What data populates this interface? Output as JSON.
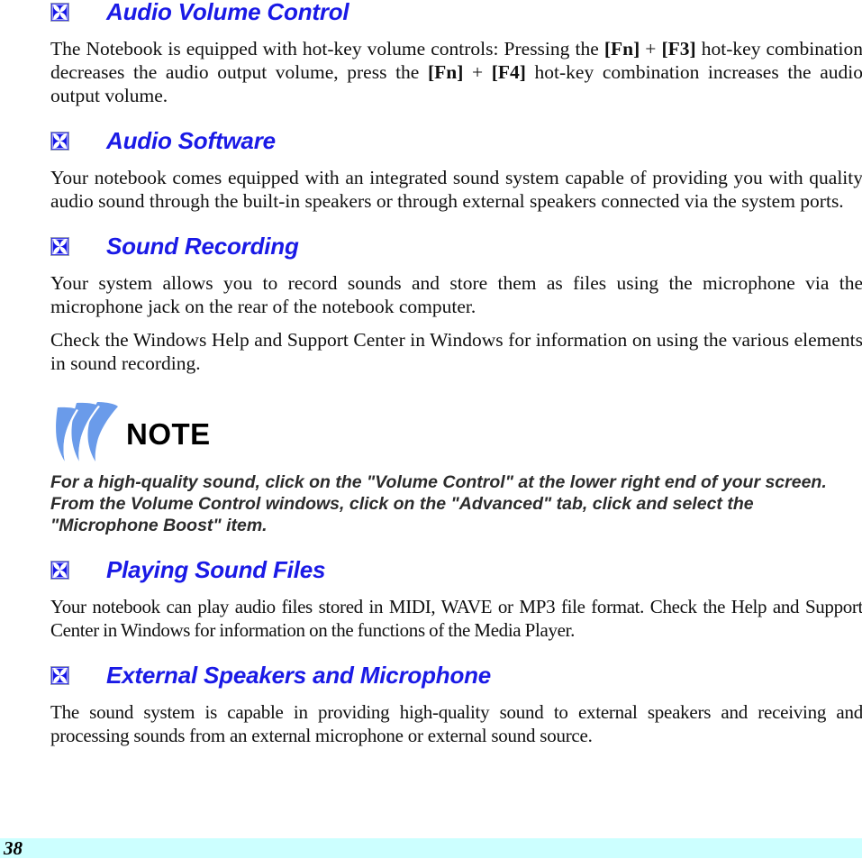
{
  "document": {
    "page_number": "38",
    "footer_band_color": "#ccffff",
    "heading_color": "#1a1ae6",
    "bullet_color": "#1414e6",
    "note_accent_color": "#5b8fe8"
  },
  "sections": [
    {
      "bullet_icon": "four-petal-flower-icon",
      "heading": "Audio Volume Control",
      "paragraphs": [
        {
          "runs": [
            {
              "text": "The Notebook is equipped with hot-key volume controls: Pressing the ",
              "bold": false
            },
            {
              "text": "[Fn]",
              "bold": true
            },
            {
              "text": " + ",
              "bold": false
            },
            {
              "text": "[F3]",
              "bold": true
            },
            {
              "text": " hot-key combination decreases the audio output volume, press the ",
              "bold": false
            },
            {
              "text": "[Fn]",
              "bold": true
            },
            {
              "text": " + ",
              "bold": false
            },
            {
              "text": "[F4]",
              "bold": true
            },
            {
              "text": " hot-key combination increases the audio output volume.",
              "bold": false
            }
          ]
        }
      ]
    },
    {
      "bullet_icon": "four-petal-flower-icon",
      "heading": "Audio Software",
      "paragraphs": [
        {
          "runs": [
            {
              "text": "Your notebook comes equipped with an integrated sound system capable of providing you with quality audio sound through the built-in speakers or through external speakers connected via the system ports.",
              "bold": false
            }
          ]
        }
      ]
    },
    {
      "bullet_icon": "four-petal-flower-icon",
      "heading": "Sound Recording",
      "paragraphs": [
        {
          "runs": [
            {
              "text": "Your system allows you to record sounds and store them as files using the microphone via the microphone jack on the rear of the notebook computer.",
              "bold": false
            }
          ]
        },
        {
          "runs": [
            {
              "text": "Check the Windows Help and Support Center in Windows for information on using the various elements in sound recording.",
              "bold": false
            }
          ]
        }
      ]
    },
    {
      "bullet_icon": "four-petal-flower-icon",
      "heading": "Playing Sound Files",
      "paragraphs": [
        {
          "runs": [
            {
              "text": "Your notebook can play audio files stored in MIDI, WAVE or MP3 file format.  Check the Help and Support Center in Windows for information on the functions of the Media Player.",
              "bold": false
            }
          ]
        }
      ]
    },
    {
      "bullet_icon": "four-petal-flower-icon",
      "heading": "External Speakers and Microphone",
      "paragraphs": [
        {
          "runs": [
            {
              "text": "The sound system is capable in providing high-quality sound to external speakers and receiving and processing sounds from an external microphone or external sound source.",
              "bold": false
            }
          ]
        }
      ]
    }
  ],
  "note": {
    "icon": "note-swoosh-icon",
    "label": "NOTE",
    "text": "For a high-quality sound, click on the \"Volume Control\" at the lower right end of your screen.   From the Volume Control windows, click on the \"Advanced\" tab, click and select the \"Microphone Boost\" item."
  }
}
